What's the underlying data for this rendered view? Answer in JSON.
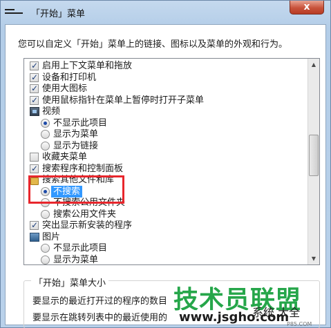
{
  "window": {
    "title": "「开始」菜单",
    "close_label": "x"
  },
  "dialog": {
    "description": "您可以自定义「开始」菜单上的链接、图标以及菜单的外观和行为。"
  },
  "options": [
    {
      "type": "checkbox",
      "checked": true,
      "label": "启用上下文菜单和拖放"
    },
    {
      "type": "checkbox",
      "checked": true,
      "label": "设备和打印机"
    },
    {
      "type": "checkbox",
      "checked": true,
      "label": "使用大图标"
    },
    {
      "type": "checkbox",
      "checked": true,
      "label": "使用鼠标指针在菜单上暂停时打开子菜单"
    },
    {
      "type": "group",
      "icon": "video-icon",
      "label": "视频"
    },
    {
      "type": "radio",
      "checked": true,
      "label": "不显示此项目"
    },
    {
      "type": "radio",
      "checked": false,
      "label": "显示为菜单"
    },
    {
      "type": "radio",
      "checked": false,
      "label": "显示为链接"
    },
    {
      "type": "checkbox",
      "checked": false,
      "label": "收藏夹菜单"
    },
    {
      "type": "checkbox",
      "checked": true,
      "label": "搜索程序和控制面板"
    },
    {
      "type": "group",
      "icon": "folder-icon",
      "label": "搜索其他文件和库"
    },
    {
      "type": "radio",
      "checked": true,
      "label": "不搜索",
      "selected": true
    },
    {
      "type": "radio",
      "checked": false,
      "label": "不搜索公用文件夹"
    },
    {
      "type": "radio",
      "checked": false,
      "label": "搜索公用文件夹"
    },
    {
      "type": "checkbox",
      "checked": true,
      "label": "突出显示新安装的程序"
    },
    {
      "type": "group",
      "icon": "pictures-icon",
      "label": "图片"
    },
    {
      "type": "radio",
      "checked": false,
      "label": "不显示此项目"
    },
    {
      "type": "radio",
      "checked": false,
      "label": "显示为菜单"
    }
  ],
  "menu_size": {
    "title": "「开始」菜单大小",
    "line1": "要显示的最近打开过的程序的数目",
    "line2": "要显示在跳转列表中的最近使用的"
  },
  "watermark": {
    "main": "技术员联盟",
    "url": "www.jsgho.com",
    "logo": "系统 大全",
    "small": "P85.COM"
  },
  "colors": {
    "highlight": "#e8262c",
    "selection": "#3399ff",
    "watermark": "#26a64a"
  }
}
